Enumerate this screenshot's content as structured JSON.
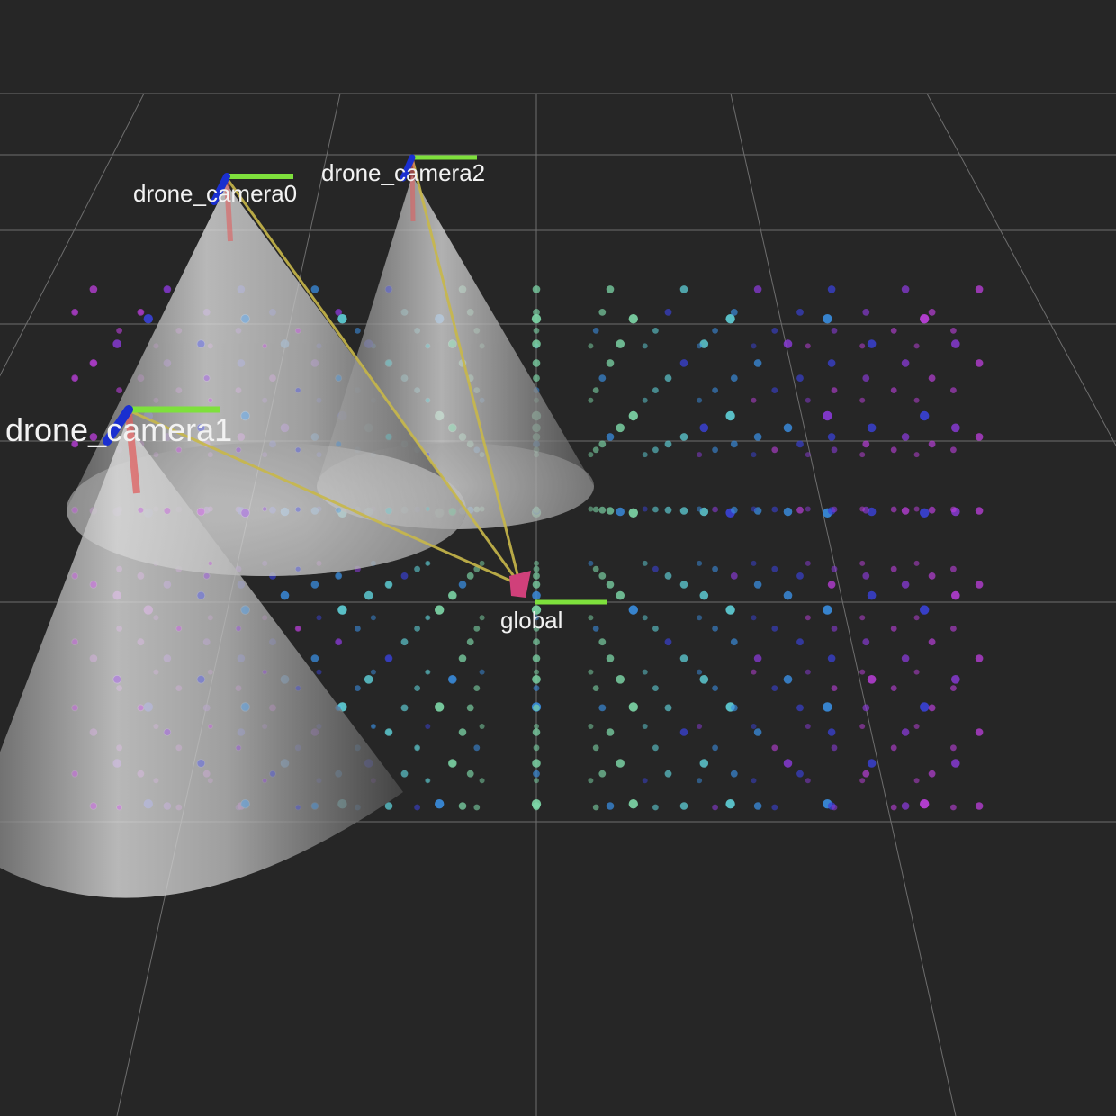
{
  "view": {
    "background_color": "#262626",
    "grid_color": "#6e6e6e"
  },
  "frames": [
    {
      "id": "drone_camera0",
      "label": "drone_camera0"
    },
    {
      "id": "drone_camera1",
      "label": "drone_camera1"
    },
    {
      "id": "drone_camera2",
      "label": "drone_camera2"
    },
    {
      "id": "global",
      "label": "global"
    }
  ],
  "colors": {
    "axis_x": "#e06060",
    "axis_y": "#7ee03c",
    "axis_z": "#1a2fd0",
    "link_line": "#c8b84a",
    "global_marker": "#d0407a",
    "cone_fill": "#cfcfcf",
    "points_palette": [
      "#c040e0",
      "#8a3ad8",
      "#3a42d8",
      "#3a8ee0",
      "#5fd0d8",
      "#7ed8a8"
    ]
  }
}
